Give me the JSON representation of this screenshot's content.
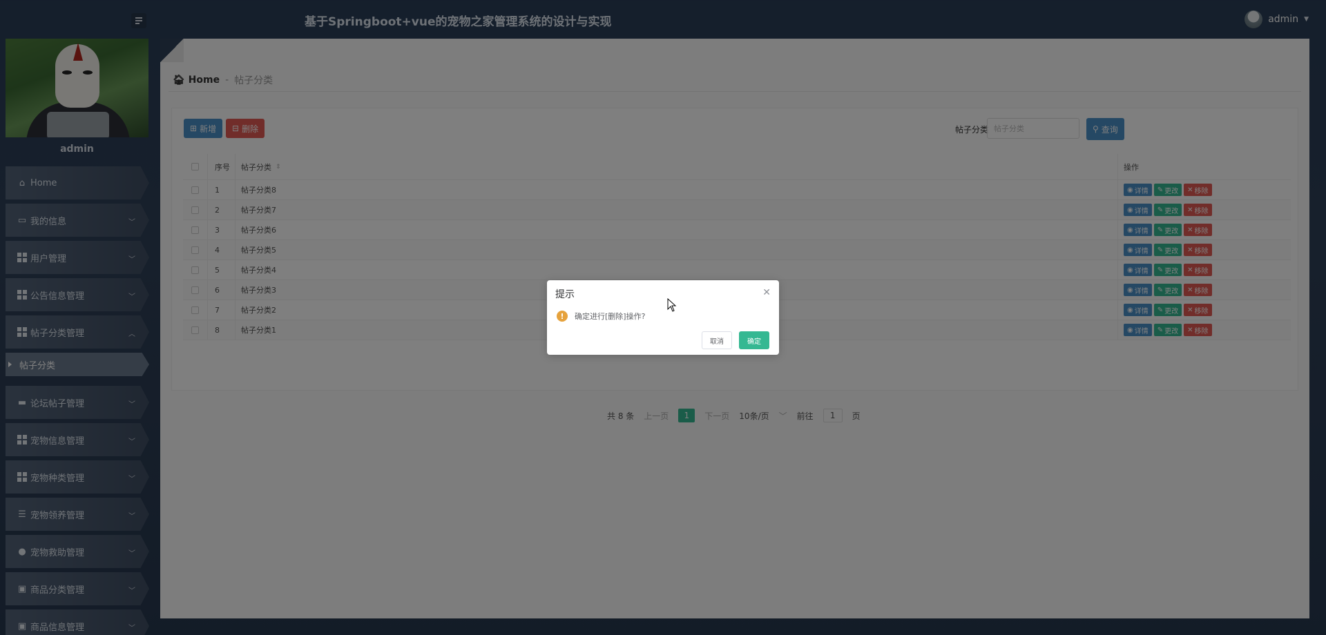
{
  "header": {
    "title": "基于Springboot+vue的宠物之家管理系统的设计与实现",
    "username": "admin"
  },
  "sidebar": {
    "username": "admin",
    "items": [
      {
        "label": "Home",
        "icon": "home-icon"
      },
      {
        "label": "我的信息",
        "icon": "card-icon"
      },
      {
        "label": "用户管理",
        "icon": "grid-icon"
      },
      {
        "label": "公告信息管理",
        "icon": "grid-icon"
      },
      {
        "label": "帖子分类管理",
        "icon": "grid-icon",
        "expanded": true
      },
      {
        "label": "论坛帖子管理",
        "icon": "briefcase-icon"
      },
      {
        "label": "宠物信息管理",
        "icon": "grid-icon"
      },
      {
        "label": "宠物种类管理",
        "icon": "grid-icon"
      },
      {
        "label": "宠物领养管理",
        "icon": "list-icon"
      },
      {
        "label": "宠物救助管理",
        "icon": "user-icon"
      },
      {
        "label": "商品分类管理",
        "icon": "clipboard-icon"
      },
      {
        "label": "商品信息管理",
        "icon": "clipboard-icon"
      }
    ],
    "sub_item": "帖子分类"
  },
  "breadcrumb": {
    "home": "Home",
    "sep": "-",
    "current": "帖子分类"
  },
  "toolbar": {
    "add_label": "新增",
    "delete_label": "删除",
    "search_label": "帖子分类",
    "search_placeholder": "帖子分类",
    "query_label": "查询"
  },
  "table": {
    "headers": {
      "no": "序号",
      "name": "帖子分类",
      "op": "操作"
    },
    "rows": [
      {
        "no": "1",
        "name": "帖子分类8"
      },
      {
        "no": "2",
        "name": "帖子分类7"
      },
      {
        "no": "3",
        "name": "帖子分类6"
      },
      {
        "no": "4",
        "name": "帖子分类5"
      },
      {
        "no": "5",
        "name": "帖子分类4"
      },
      {
        "no": "6",
        "name": "帖子分类3"
      },
      {
        "no": "7",
        "name": "帖子分类2"
      },
      {
        "no": "8",
        "name": "帖子分类1"
      }
    ],
    "actions": {
      "detail": "详情",
      "edit": "更改",
      "remove": "移除"
    }
  },
  "pagination": {
    "total": "共 8 条",
    "prev": "上一页",
    "page": "1",
    "next": "下一页",
    "size": "10条/页",
    "goto_label": "前往",
    "goto_value": "1",
    "goto_unit": "页"
  },
  "dialog": {
    "title": "提示",
    "message": "确定进行[删除]操作?",
    "cancel": "取消",
    "confirm": "确定"
  },
  "colors": {
    "primary": "#4a90c9",
    "success": "#35b892",
    "danger": "#e35b55",
    "warning": "#e6a23c"
  }
}
